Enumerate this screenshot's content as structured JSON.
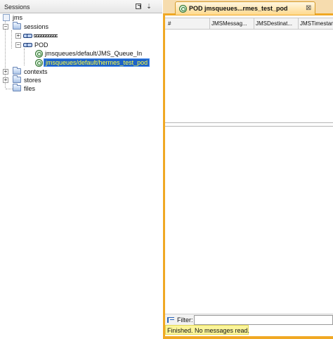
{
  "sessions_panel": {
    "title": "Sessions",
    "maximize_icon": "maximize-icon",
    "pin_icon": "pin-icon"
  },
  "tree": {
    "root": "jms",
    "sessions": "sessions",
    "session_redacted": "",
    "pod": "POD",
    "queue_in": "jmsqueues/default/JMS_Queue_In",
    "queue_selected": "jmsqueues/default/hermes_test_pod",
    "contexts": "contexts",
    "stores": "stores",
    "files": "files"
  },
  "messages_panel": {
    "tab_label": "POD jmsqueues...rmes_test_pod",
    "tab_close": "⊠",
    "columns": [
      "#",
      "JMSMessag...",
      "JMSDestinat...",
      "JMSTimestam"
    ],
    "filter_label": "Filter:",
    "filter_value": "",
    "status": "Finished. No messages read."
  },
  "colors": {
    "tab_accent": "#f0a824",
    "selection_bg": "#1d63c8",
    "selection_text": "#ffff40",
    "status_highlight": "#fbf59a"
  }
}
